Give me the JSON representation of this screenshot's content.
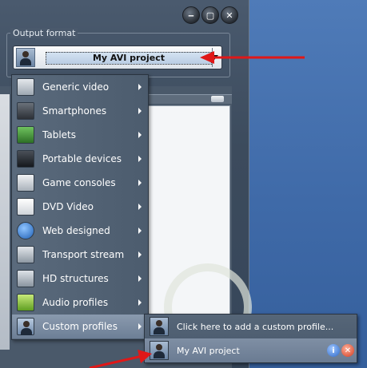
{
  "window": {
    "group_label": "Output format",
    "selected_format": "My AVI project",
    "controls": {
      "minimize": "‒",
      "maximize": "▢",
      "close": "✕"
    }
  },
  "menu": {
    "items": [
      {
        "label": "Generic video",
        "icon": "film-icon",
        "color": "#cfd6dd"
      },
      {
        "label": "Smartphones",
        "icon": "smartphone-icon",
        "color": "#444a52"
      },
      {
        "label": "Tablets",
        "icon": "tablet-icon",
        "color": "#3f8f3a"
      },
      {
        "label": "Portable devices",
        "icon": "portable-player-icon",
        "color": "#2a2e33"
      },
      {
        "label": "Game consoles",
        "icon": "gamepad-icon",
        "color": "#d9dde1"
      },
      {
        "label": "DVD Video",
        "icon": "dvd-icon",
        "color": "#f2f2f2"
      },
      {
        "label": "Web designed",
        "icon": "globe-icon",
        "color": "#3b82d6"
      },
      {
        "label": "Transport stream",
        "icon": "film-reel-icon",
        "color": "#c7cdd3"
      },
      {
        "label": "HD structures",
        "icon": "hd-film-icon",
        "color": "#bfc6cd"
      },
      {
        "label": "Audio profiles",
        "icon": "music-note-icon",
        "color": "#9ccf4a"
      },
      {
        "label": "Custom profiles",
        "icon": "custom-profile-icon",
        "color": "#8aa2c0"
      }
    ],
    "active_index": 10
  },
  "submenu": {
    "items": [
      {
        "label": "Click here to add a custom profile..."
      },
      {
        "label": "My AVI project",
        "info": "i",
        "delete": "✕"
      }
    ]
  }
}
